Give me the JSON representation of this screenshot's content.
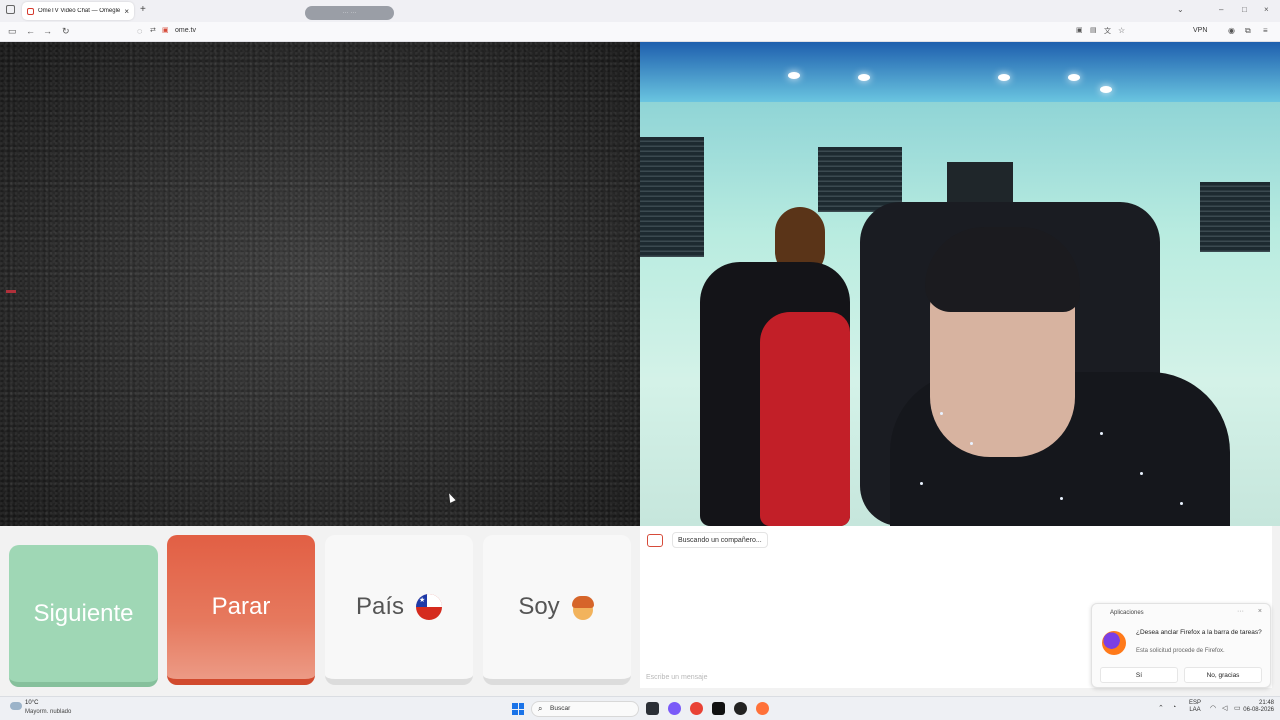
{
  "browser": {
    "tab_title": "OmeTV Video Chat — Omegle",
    "tab_close": "×",
    "new_tab": "+",
    "pill_text": "··· ···",
    "url": "ome.tv",
    "vpn": "VPN",
    "window_controls": {
      "dropdown": "⌄",
      "minimize": "–",
      "maximize": "□",
      "close": "×"
    }
  },
  "actions": {
    "next_label": "Siguiente",
    "stop_label": "Parar",
    "country_label": "País",
    "gender_label": "Soy"
  },
  "chat": {
    "status_message": "Buscando un compañero...",
    "input_placeholder": "Escribe un mensaje"
  },
  "notification": {
    "app_name": "Aplicaciones",
    "title": "¿Desea anclar Firefox a la barra de tareas?",
    "subtitle": "Esta solicitud procede de Firefox.",
    "yes_label": "Sí",
    "no_label": "No, gracias"
  },
  "taskbar": {
    "weather_temp": "10°C",
    "weather_condition": "Mayorm. nublado",
    "search_label": "Buscar",
    "lang_top": "ESP",
    "lang_bottom": "LAA",
    "time": "21:48",
    "date": "06-08-2026"
  },
  "colors": {
    "next": "#9fd7b5",
    "stop": "#e25f44",
    "progress": "#7fcca7"
  }
}
